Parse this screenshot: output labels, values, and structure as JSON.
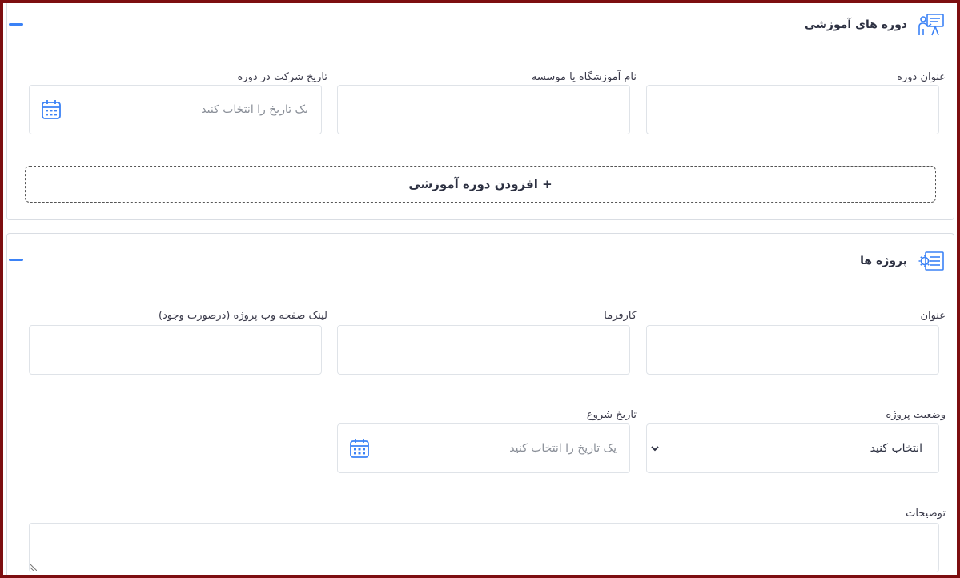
{
  "courses": {
    "title": "دوره های آموزشی",
    "icon": "presentation-icon",
    "fields": {
      "course_title_label": "عنوان دوره",
      "institute_label": "نام آموزشگاه یا موسسه",
      "date_label": "تاریخ شرکت در دوره",
      "date_placeholder": "یک تاریخ را انتخاب کنید"
    },
    "add_button": "+ افزودن دوره آموزشی"
  },
  "projects": {
    "title": "پروژه ها",
    "icon": "project-gear-icon",
    "fields": {
      "title_label": "عنوان",
      "employer_label": "کارفرما",
      "link_label": "لینک صفحه وب پروژه (درصورت وجود)",
      "status_label": "وضعیت پروژه",
      "status_value": "انتخاب کنید",
      "start_date_label": "تاریخ شروع",
      "start_date_placeholder": "یک تاریخ را انتخاب کنید",
      "description_label": "توضیحات"
    }
  },
  "colors": {
    "accent": "#3b82f6",
    "frame": "#7d0e10",
    "border": "#dfe3e8"
  }
}
